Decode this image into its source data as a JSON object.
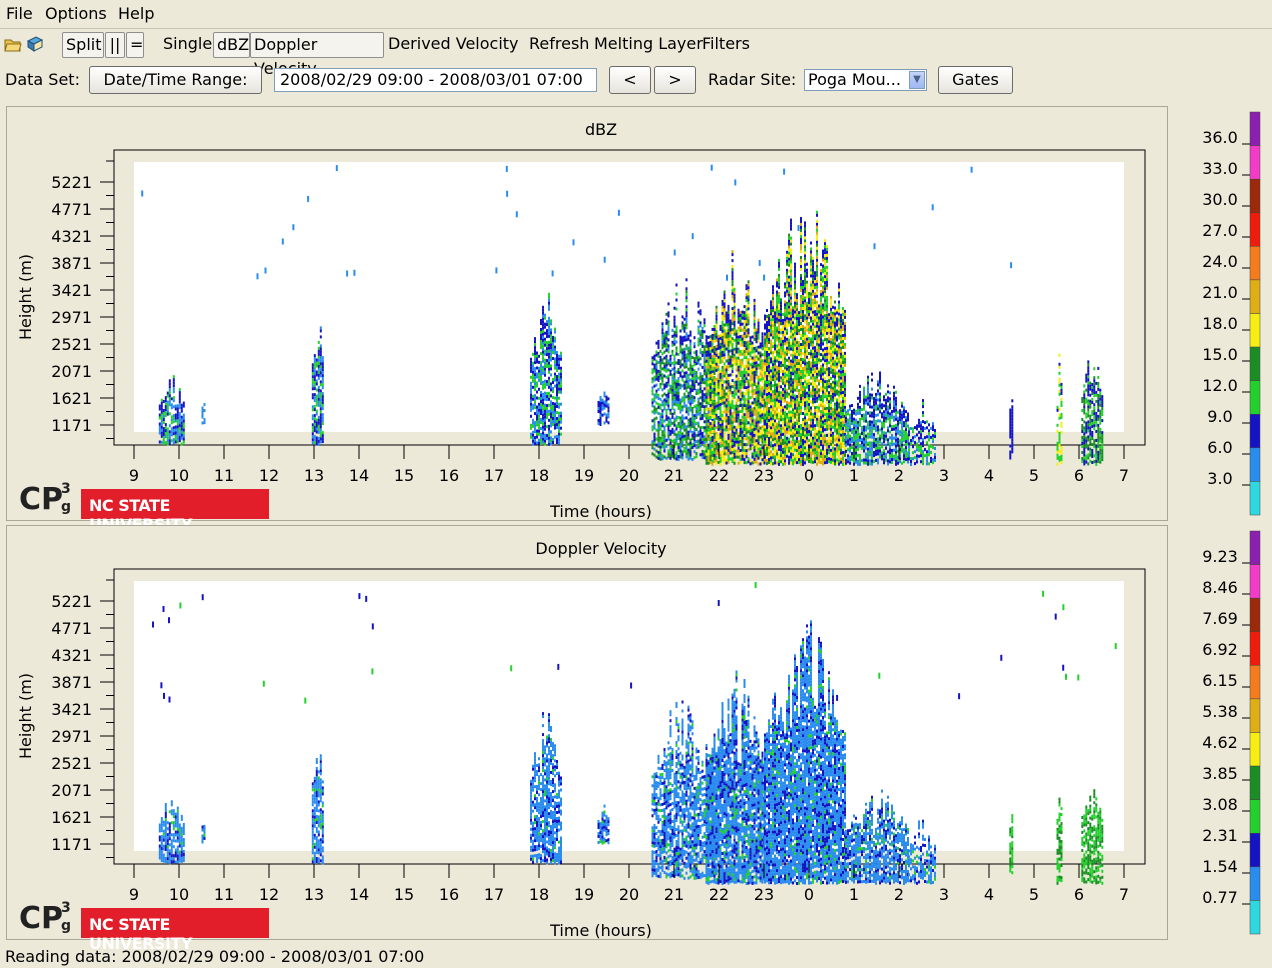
{
  "menu": {
    "items": [
      "File",
      "Options",
      "Help"
    ]
  },
  "toolbar": {
    "split": "Split",
    "parallel": "||",
    "equal": "=",
    "single": "Single",
    "dbz": "dBZ",
    "doppler": "Doppler Velocity",
    "derived": "Derived Velocity",
    "refresh": "Refresh",
    "melting": "Melting Layer",
    "filters": "Filters"
  },
  "dataset": {
    "label": "Data Set:",
    "range_button": "Date/Time Range:",
    "range_value": "2008/02/29 09:00 - 2008/03/01 07:00",
    "prev": "<",
    "next": ">",
    "radar_label": "Radar Site:",
    "radar_value": "Poga Mou...",
    "gates": "Gates"
  },
  "panels": [
    {
      "title": "dBZ",
      "ylabel": "Height (m)",
      "xlabel": "Time (hours)",
      "yticks": [
        "5221",
        "4771",
        "4321",
        "3871",
        "3421",
        "2971",
        "2521",
        "2071",
        "1621",
        "1171"
      ],
      "xticks": [
        "9",
        "10",
        "11",
        "12",
        "13",
        "14",
        "15",
        "16",
        "17",
        "18",
        "19",
        "20",
        "21",
        "22",
        "23",
        "0",
        "1",
        "2",
        "3",
        "4",
        "5",
        "6",
        "7"
      ],
      "colorbar": [
        "36.0",
        "33.0",
        "30.0",
        "27.0",
        "24.0",
        "21.0",
        "18.0",
        "15.0",
        "12.0",
        "9.0",
        "6.0",
        "3.0"
      ],
      "mode": "dbz"
    },
    {
      "title": "Doppler Velocity",
      "ylabel": "Height (m)",
      "xlabel": "Time (hours)",
      "yticks": [
        "5221",
        "4771",
        "4321",
        "3871",
        "3421",
        "2971",
        "2521",
        "2071",
        "1621",
        "1171"
      ],
      "xticks": [
        "9",
        "10",
        "11",
        "12",
        "13",
        "14",
        "15",
        "16",
        "17",
        "18",
        "19",
        "20",
        "21",
        "22",
        "23",
        "0",
        "1",
        "2",
        "3",
        "4",
        "5",
        "6",
        "7"
      ],
      "colorbar": [
        "9.23",
        "8.46",
        "7.69",
        "6.92",
        "6.15",
        "5.38",
        "4.62",
        "3.85",
        "3.08",
        "2.31",
        "1.54",
        "0.77"
      ],
      "mode": "vel"
    }
  ],
  "colors": {
    "scale": [
      "#8a1fb0",
      "#f23cc8",
      "#9c2a0a",
      "#ee1c0c",
      "#f47c1c",
      "#dfae14",
      "#f6ee12",
      "#1a8e24",
      "#22d12c",
      "#1414c4",
      "#2a8cee",
      "#2fd8e0"
    ]
  },
  "logo": {
    "cp3g": "CP",
    "university": "NC STATE UNIVERSITY"
  },
  "status": "Reading data: 2008/02/29 09:00 - 2008/03/01 07:00"
}
